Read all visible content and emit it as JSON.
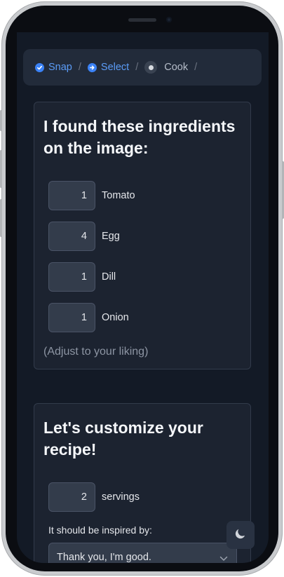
{
  "breadcrumb": {
    "items": [
      {
        "label": "Snap",
        "state": "completed",
        "icon": "check-circle-icon"
      },
      {
        "label": "Select",
        "state": "current",
        "icon": "arrow-right-circle-icon"
      },
      {
        "label": "Cook",
        "state": "pending",
        "icon": "dot-circle-icon"
      }
    ],
    "separator": "/"
  },
  "ingredients_card": {
    "title": "I found these ingredients on the image:",
    "items": [
      {
        "quantity": "1",
        "name": "Tomato"
      },
      {
        "quantity": "4",
        "name": "Egg"
      },
      {
        "quantity": "1",
        "name": "Dill"
      },
      {
        "quantity": "1",
        "name": "Onion"
      }
    ],
    "note": "(Adjust to your liking)"
  },
  "customize_card": {
    "title": "Let's customize your recipe!",
    "servings": {
      "value": "2",
      "label": "servings"
    },
    "inspired_label": "It should be inspired by:",
    "inspired_select": {
      "selected": "Thank you, I'm good."
    }
  },
  "theme_toggle": {
    "icon": "moon-icon"
  },
  "colors": {
    "accent": "#3b82f6",
    "background": "#131a26",
    "card": "#1c2330"
  }
}
